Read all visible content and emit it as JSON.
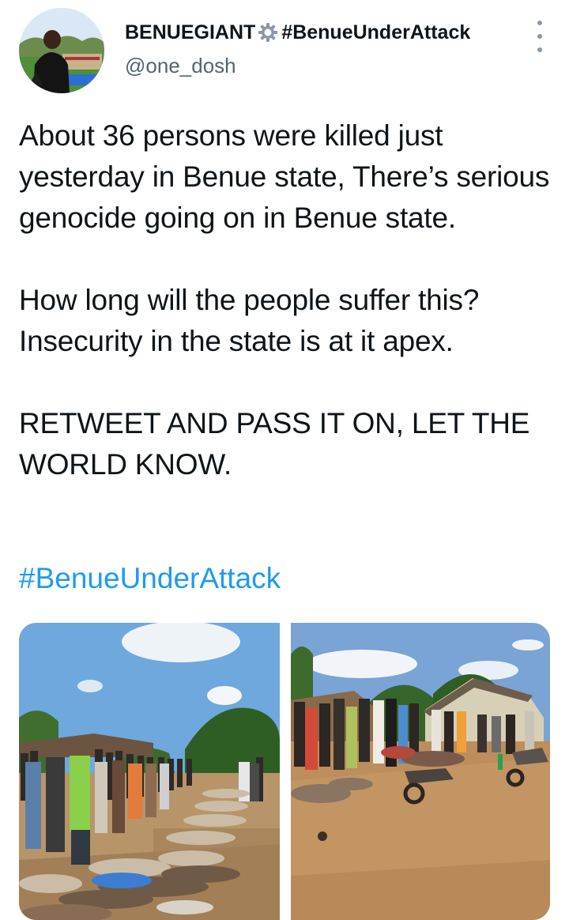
{
  "tweet": {
    "author": {
      "display_name": "BENUEGIANT",
      "verified_icon": "gear-icon",
      "name_suffix": "#BenueUnderAttack",
      "handle": "@one_dosh"
    },
    "more_icon": "vertical-ellipsis-icon",
    "text": {
      "paragraph_1": "About 36 persons were killed just yesterday in Benue state, There’s serious genocide going on in Benue state.",
      "paragraph_2": "How long will the people suffer this? Insecurity in the state is at it apex.",
      "paragraph_3": "RETWEET AND PASS IT ON, LET THE WORLD KNOW."
    },
    "hashtag": "#BenueUnderAttack",
    "media": [
      {
        "kind": "photo"
      },
      {
        "kind": "photo"
      }
    ]
  },
  "colors": {
    "text": "#0f1419",
    "secondary": "#536471",
    "link": "#1d9bf0",
    "background": "#ffffff"
  }
}
